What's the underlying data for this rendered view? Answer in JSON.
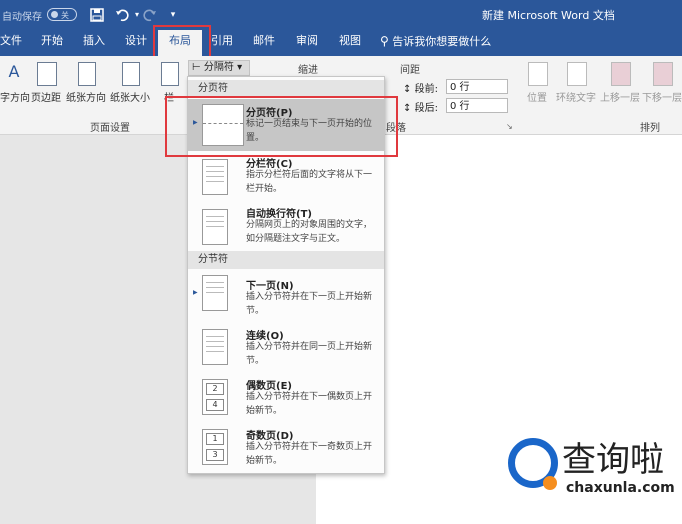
{
  "titlebar": {
    "autosave_label": "自动保存",
    "autosave_state": "关",
    "save_icon": "save-icon",
    "undo_icon": "undo-icon",
    "redo_icon": "redo-icon",
    "customize_icon": "customize-qat-icon",
    "document_title": "新建 Microsoft Word 文档"
  },
  "tabs": [
    {
      "label": "文件"
    },
    {
      "label": "开始"
    },
    {
      "label": "插入"
    },
    {
      "label": "设计"
    },
    {
      "label": "布局"
    },
    {
      "label": "引用"
    },
    {
      "label": "邮件"
    },
    {
      "label": "审阅"
    },
    {
      "label": "视图"
    }
  ],
  "search": {
    "placeholder": "告诉我你想要做什么"
  },
  "ribbon": {
    "page_setup": {
      "buttons": [
        {
          "label": "字方向"
        },
        {
          "label": "页边距"
        },
        {
          "label": "纸张方向"
        },
        {
          "label": "纸张大小"
        },
        {
          "label": "栏"
        }
      ],
      "breaks_button": "分隔符",
      "group_label": "页面设置"
    },
    "indent": {
      "label": "缩进"
    },
    "spacing": {
      "label": "间距",
      "before_label": "段前:",
      "before_value": "0 行",
      "after_label": "段后:",
      "after_value": "0 行"
    },
    "paragraph_group_label": "段落",
    "arrange": {
      "buttons": [
        {
          "label": "位置"
        },
        {
          "label": "环绕文字"
        },
        {
          "label": "上移一层"
        },
        {
          "label": "下移一层"
        }
      ],
      "group_label": "排列"
    }
  },
  "menu": {
    "page_breaks_header": "分页符",
    "section_breaks_header": "分节符",
    "items": [
      {
        "title": "分页符(P)",
        "desc": "标记一页结束与下一页开始的位置。"
      },
      {
        "title": "分栏符(C)",
        "desc": "指示分栏符后面的文字将从下一栏开始。"
      },
      {
        "title": "自动换行符(T)",
        "desc": "分隔网页上的对象周围的文字，如分隔题注文字与正文。"
      },
      {
        "title": "下一页(N)",
        "desc": "插入分节符并在下一页上开始新节。"
      },
      {
        "title": "连续(O)",
        "desc": "插入分节符并在同一页上开始新节。"
      },
      {
        "title": "偶数页(E)",
        "desc": "插入分节符并在下一偶数页上开始新节。",
        "icon_numbers": [
          "2",
          "4"
        ]
      },
      {
        "title": "奇数页(D)",
        "desc": "插入分节符并在下一奇数页上开始新节。",
        "icon_numbers": [
          "1",
          "3"
        ]
      }
    ]
  },
  "watermark": {
    "text": "查询啦",
    "url": "chaxunla.com"
  },
  "colors": {
    "title_bar": "#2b579a",
    "highlight": "#e0393e",
    "ribbon": "#f3f3f3"
  }
}
